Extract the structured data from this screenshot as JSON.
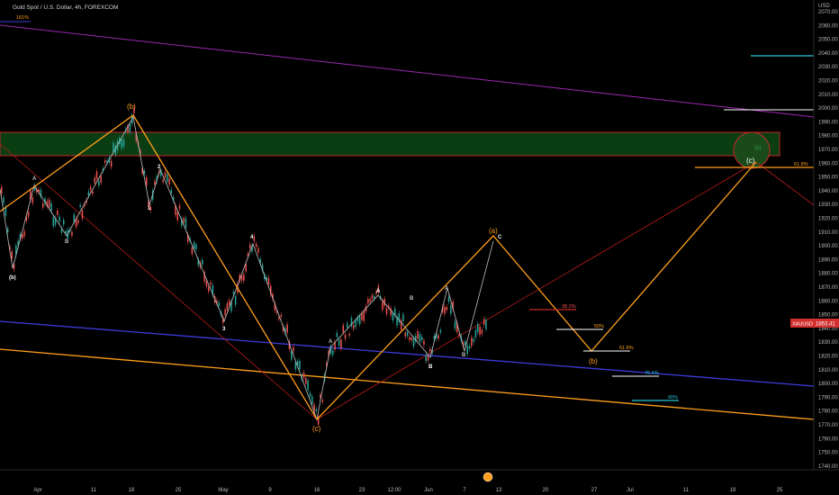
{
  "header": {
    "title": "Gold Spot / U.S. Dollar, 4h, FOREXCOM"
  },
  "price_axis": {
    "currency": "USD",
    "ticks": [
      2070,
      2060,
      2050,
      2040,
      2030,
      2020,
      2010,
      2000,
      1990,
      1980,
      1970,
      1960,
      1950,
      1940,
      1930,
      1920,
      1910,
      1900,
      1890,
      1880,
      1870,
      1860,
      1850,
      1840,
      1830,
      1820,
      1810,
      1800,
      1790,
      1780,
      1770,
      1760,
      1750,
      1740
    ]
  },
  "time_axis": {
    "labels": [
      "Apr",
      "11",
      "18",
      "25",
      "May",
      "9",
      "16",
      "23",
      "12:00",
      "Jun",
      "7",
      "13",
      "20",
      "27",
      "Jul",
      "11",
      "18",
      "25"
    ]
  },
  "price_badge": {
    "symbol": "XAUUSD",
    "value": "1853.41"
  },
  "wave_labels": {
    "b_top": "(b)",
    "b_bottom": "(b)",
    "c_low": "(c)",
    "a_target": "(a)",
    "b_target": "(b)",
    "c_target": "(c)",
    "n1": "1",
    "n2": "2",
    "n3": "3",
    "n4": "4",
    "A1": "A",
    "B1": "B",
    "A2": "A",
    "A3": "A",
    "A4": "A",
    "B2": "B",
    "B3": "B",
    "C1": "C",
    "B4": "B"
  },
  "fib_labels": {
    "f161": "161%",
    "f618_top": "61.8%",
    "f382": "38.2%",
    "f50": "50%",
    "f618_low": "61.8%",
    "f764": "76.4%",
    "f90": "90%"
  },
  "colors": {
    "background": "#000000",
    "orange": "#ff9f1c",
    "purple": "#9c27b0",
    "blue": "#3f3bd9",
    "red": "#b71c1c",
    "green_zone": "#0b3d12",
    "up_candle": "#26a69a",
    "down_candle": "#ef5350",
    "teal": "#26c6da"
  },
  "chart_data": {
    "type": "line",
    "title": "Gold Spot / U.S. Dollar, 4h, FOREXCOM",
    "ylabel": "USD",
    "ylim": [
      1735,
      2070
    ],
    "series": [
      {
        "x": [
          "Mar 31",
          "Apr 7",
          "Apr 14",
          "Apr 19",
          "Apr 23",
          "May 2",
          "May 17",
          "May 31",
          "Jun 9",
          "Jun 22",
          "Jun 24",
          "Jul 13"
        ],
        "values": [
          1955,
          1890,
          1940,
          2000,
          1940,
          1860,
          1785,
          1880,
          1830,
          1848,
          1838,
          1965
        ]
      }
    ]
  }
}
